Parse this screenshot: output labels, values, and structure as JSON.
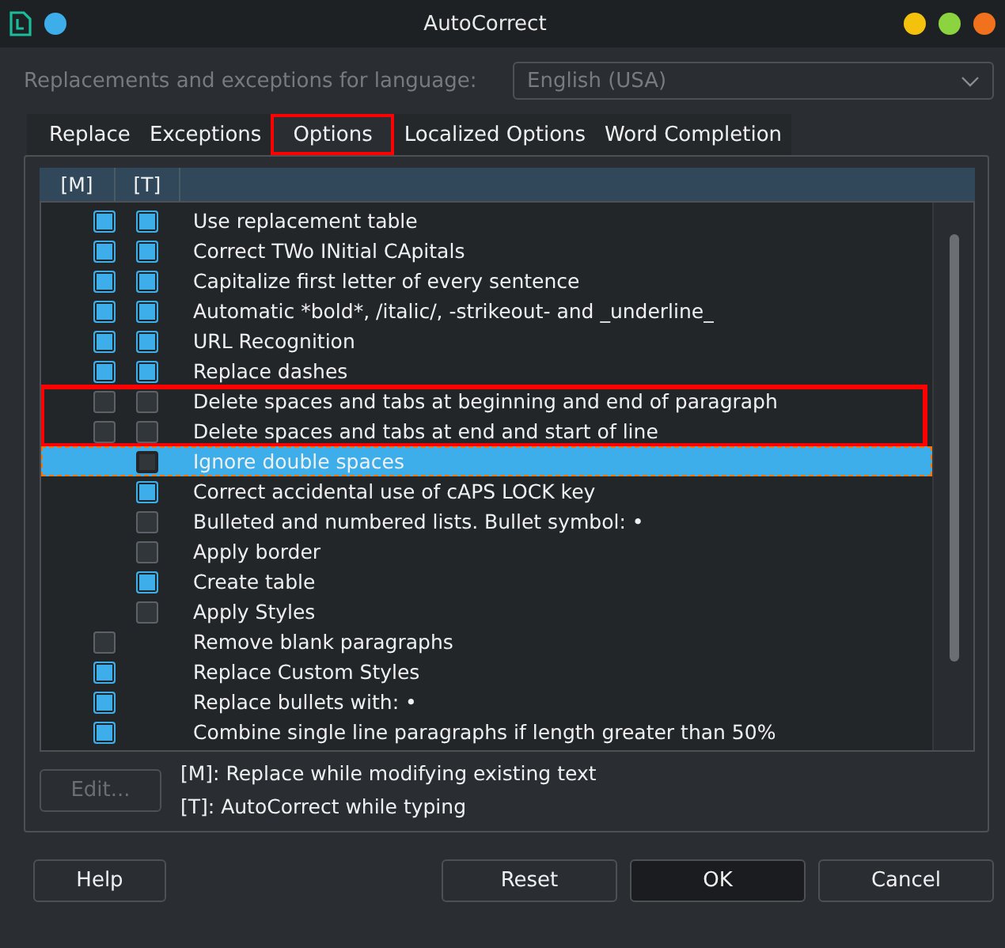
{
  "window": {
    "title": "AutoCorrect"
  },
  "language": {
    "label": "Replacements and exceptions for language:",
    "value": "English (USA)",
    "disabled": true
  },
  "tabs": [
    {
      "label": "Replace",
      "selected": false,
      "highlighted": false
    },
    {
      "label": "Exceptions",
      "selected": false,
      "highlighted": false
    },
    {
      "label": "Options",
      "selected": true,
      "highlighted": true
    },
    {
      "label": "Localized Options",
      "selected": false,
      "highlighted": false
    },
    {
      "label": "Word Completion",
      "selected": false,
      "highlighted": false
    }
  ],
  "table": {
    "columns": [
      "[M]",
      "[T]"
    ],
    "rows": [
      {
        "m": true,
        "t": true,
        "label": "Use replacement table",
        "selected": false,
        "highlighted": false
      },
      {
        "m": true,
        "t": true,
        "label": "Correct TWo INitial CApitals",
        "selected": false,
        "highlighted": false
      },
      {
        "m": true,
        "t": true,
        "label": "Capitalize first letter of every sentence",
        "selected": false,
        "highlighted": false
      },
      {
        "m": true,
        "t": true,
        "label": "Automatic *bold*, /italic/, -strikeout- and _underline_",
        "selected": false,
        "highlighted": false
      },
      {
        "m": true,
        "t": true,
        "label": "URL Recognition",
        "selected": false,
        "highlighted": false
      },
      {
        "m": true,
        "t": true,
        "label": "Replace dashes",
        "selected": false,
        "highlighted": false
      },
      {
        "m": false,
        "t": false,
        "label": "Delete spaces and tabs at beginning and end of paragraph",
        "selected": false,
        "highlighted": true
      },
      {
        "m": false,
        "t": false,
        "label": "Delete spaces and tabs at end and start of line",
        "selected": false,
        "highlighted": true
      },
      {
        "t": false,
        "label": "Ignore double spaces",
        "selected": true,
        "highlighted": false
      },
      {
        "t": true,
        "label": "Correct accidental use of cAPS LOCK key",
        "selected": false,
        "highlighted": false
      },
      {
        "t": false,
        "label": "Bulleted and numbered lists. Bullet symbol: •",
        "selected": false,
        "highlighted": false
      },
      {
        "t": false,
        "label": "Apply border",
        "selected": false,
        "highlighted": false
      },
      {
        "t": true,
        "label": "Create table",
        "selected": false,
        "highlighted": false
      },
      {
        "t": false,
        "label": "Apply Styles",
        "selected": false,
        "highlighted": false
      },
      {
        "m": false,
        "label": "Remove blank paragraphs",
        "selected": false,
        "highlighted": false
      },
      {
        "m": true,
        "label": "Replace Custom Styles",
        "selected": false,
        "highlighted": false
      },
      {
        "m": true,
        "label": "Replace bullets with: •",
        "selected": false,
        "highlighted": false
      },
      {
        "m": true,
        "label": "Combine single line paragraphs if length greater than 50%",
        "selected": false,
        "highlighted": false
      }
    ]
  },
  "edit_button": {
    "label": "Edit...",
    "disabled": true
  },
  "legend": [
    "[M]: Replace while modifying existing text",
    "[T]: AutoCorrect while typing"
  ],
  "buttons": [
    {
      "label": "Help",
      "default": false
    },
    {
      "label": "Reset",
      "default": false
    },
    {
      "label": "OK",
      "default": true
    },
    {
      "label": "Cancel",
      "default": false
    }
  ]
}
